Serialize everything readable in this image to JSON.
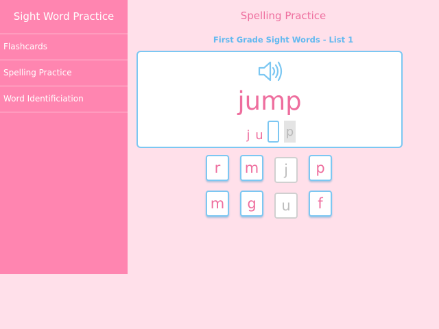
{
  "sidebar": {
    "title": "Sight Word Practice",
    "items": [
      {
        "label": "Flashcards"
      },
      {
        "label": "Spelling Practice"
      },
      {
        "label": "Word Identificiation"
      }
    ]
  },
  "main": {
    "title": "Spelling Practice",
    "subtitle": "First Grade Sight Words - List 1",
    "speaker_icon": "speaker-icon",
    "word": "jump",
    "slots": [
      {
        "letter": "j",
        "state": "filled"
      },
      {
        "letter": "u",
        "state": "filled"
      },
      {
        "letter": "",
        "state": "blank"
      },
      {
        "letter": "p",
        "state": "hint"
      }
    ],
    "tiles": [
      {
        "letter": "r",
        "state": "available"
      },
      {
        "letter": "m",
        "state": "available"
      },
      {
        "letter": "j",
        "state": "used"
      },
      {
        "letter": "p",
        "state": "available"
      },
      {
        "letter": "m",
        "state": "available"
      },
      {
        "letter": "g",
        "state": "available"
      },
      {
        "letter": "u",
        "state": "used"
      },
      {
        "letter": "f",
        "state": "available"
      }
    ]
  },
  "colors": {
    "sidebar": "#ff85b0",
    "background": "#ffe0ea",
    "accent_pink": "#ee6e9e",
    "accent_blue": "#7cc7f2"
  }
}
